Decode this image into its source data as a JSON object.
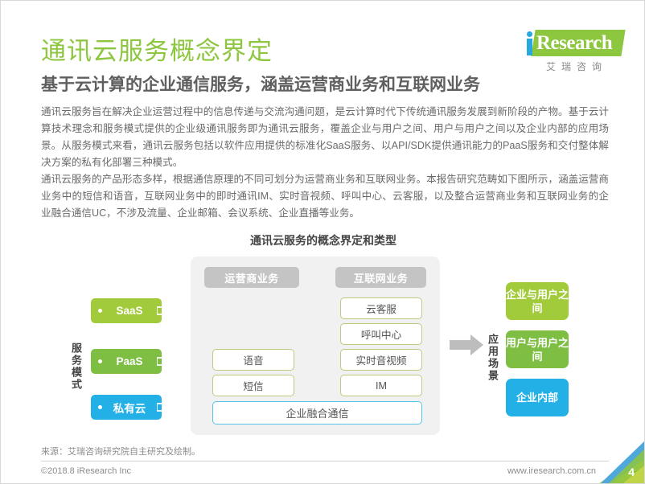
{
  "brand": {
    "logo_i": "i",
    "logo_word": "Research",
    "logo_cn": "艾瑞咨询",
    "accent_green": "#8DC63F",
    "accent_blue": "#29A8E0"
  },
  "header": {
    "title": "通讯云服务概念界定",
    "subtitle": "基于云计算的企业通信服务，涵盖运营商业务和互联网业务"
  },
  "body": {
    "paragraph_1": "通讯云服务旨在解决企业运营过程中的信息传递与交流沟通问题，是云计算时代下传统通讯服务发展到新阶段的产物。基于云计算技术理念和服务模式提供的企业级通讯服务即为通讯云服务，覆盖企业与用户之间、用户与用户之间以及企业内部的应用场景。从服务模式来看，通讯云服务包括以软件应用提供的标准化SaaS服务、以API/SDK提供通讯能力的PaaS服务和交付整体解决方案的私有化部署三种模式。",
    "paragraph_2": "通讯云服务的产品形态多样，根据通信原理的不同可划分为运营商业务和互联网业务。本报告研究范畴如下图所示，涵盖运营商业务中的短信和语音，互联网业务中的即时通讯IM、实时音视频、呼叫中心、云客服，以及整合运营商业务和互联网业务的企业融合通信UC，不涉及流量、企业邮箱、会议系统、企业直播等业务。"
  },
  "chart_data": {
    "type": "diagram",
    "title": "通讯云服务的概念界定和类型",
    "axis_labels": {
      "left": "服务模式",
      "right": "应用场景"
    },
    "service_modes": [
      {
        "label": "SaaS",
        "color": "#A2CB3B"
      },
      {
        "label": "PaaS",
        "color": "#7DBE43"
      },
      {
        "label": "私有云",
        "color": "#22B0E6"
      }
    ],
    "categories": [
      {
        "label": "运营商业务",
        "color": "#C4C4C4"
      },
      {
        "label": "互联网业务",
        "color": "#C4C4C4"
      }
    ],
    "telecom_services": [
      "语音",
      "短信"
    ],
    "internet_services": [
      "云客服",
      "呼叫中心",
      "实时音视频",
      "IM"
    ],
    "converged_service": "企业融合通信",
    "scenarios": [
      {
        "label": "企业与用户之间",
        "color": "#A2CB3B"
      },
      {
        "label": "用户与用户之间",
        "color": "#7DBE43"
      },
      {
        "label": "企业内部",
        "color": "#22B0E6"
      }
    ]
  },
  "footer": {
    "source": "来源：艾瑞咨询研究院自主研究及绘制。",
    "copyright": "©2018.8 iResearch Inc",
    "website": "www.iresearch.com.cn",
    "page_number": "4"
  }
}
